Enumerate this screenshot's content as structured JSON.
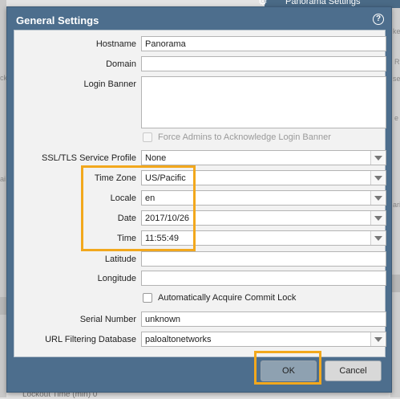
{
  "background": {
    "header_title": "Panorama Settings",
    "side_labels": [
      "ke",
      "ck",
      "ai",
      "R",
      "se",
      "e",
      "ariz"
    ],
    "bottom_text": "Lockout Time (min)   0"
  },
  "dialog": {
    "title": "General Settings",
    "help_icon": "?",
    "fields": {
      "hostname": {
        "label": "Hostname",
        "value": "Panorama"
      },
      "domain": {
        "label": "Domain",
        "value": ""
      },
      "login_banner": {
        "label": "Login Banner",
        "value": ""
      },
      "force_ack": {
        "label": "Force Admins to Acknowledge Login Banner",
        "checked": false,
        "disabled": true
      },
      "ssl_tls_profile": {
        "label": "SSL/TLS Service Profile",
        "value": "None"
      },
      "time_zone": {
        "label": "Time Zone",
        "value": "US/Pacific"
      },
      "locale": {
        "label": "Locale",
        "value": "en"
      },
      "date": {
        "label": "Date",
        "value": "2017/10/26"
      },
      "time": {
        "label": "Time",
        "value": "11:55:49"
      },
      "latitude": {
        "label": "Latitude",
        "value": ""
      },
      "longitude": {
        "label": "Longitude",
        "value": ""
      },
      "auto_commit_lock": {
        "label": "Automatically Acquire Commit Lock",
        "checked": false
      },
      "serial_number": {
        "label": "Serial Number",
        "value": "unknown"
      },
      "url_filtering_db": {
        "label": "URL Filtering Database",
        "value": "paloaltonetworks"
      }
    },
    "buttons": {
      "ok": "OK",
      "cancel": "Cancel"
    }
  },
  "colors": {
    "dialog_header": "#4d6e8d",
    "highlight": "#f2a81d",
    "ok_button": "#8ea1b1"
  }
}
